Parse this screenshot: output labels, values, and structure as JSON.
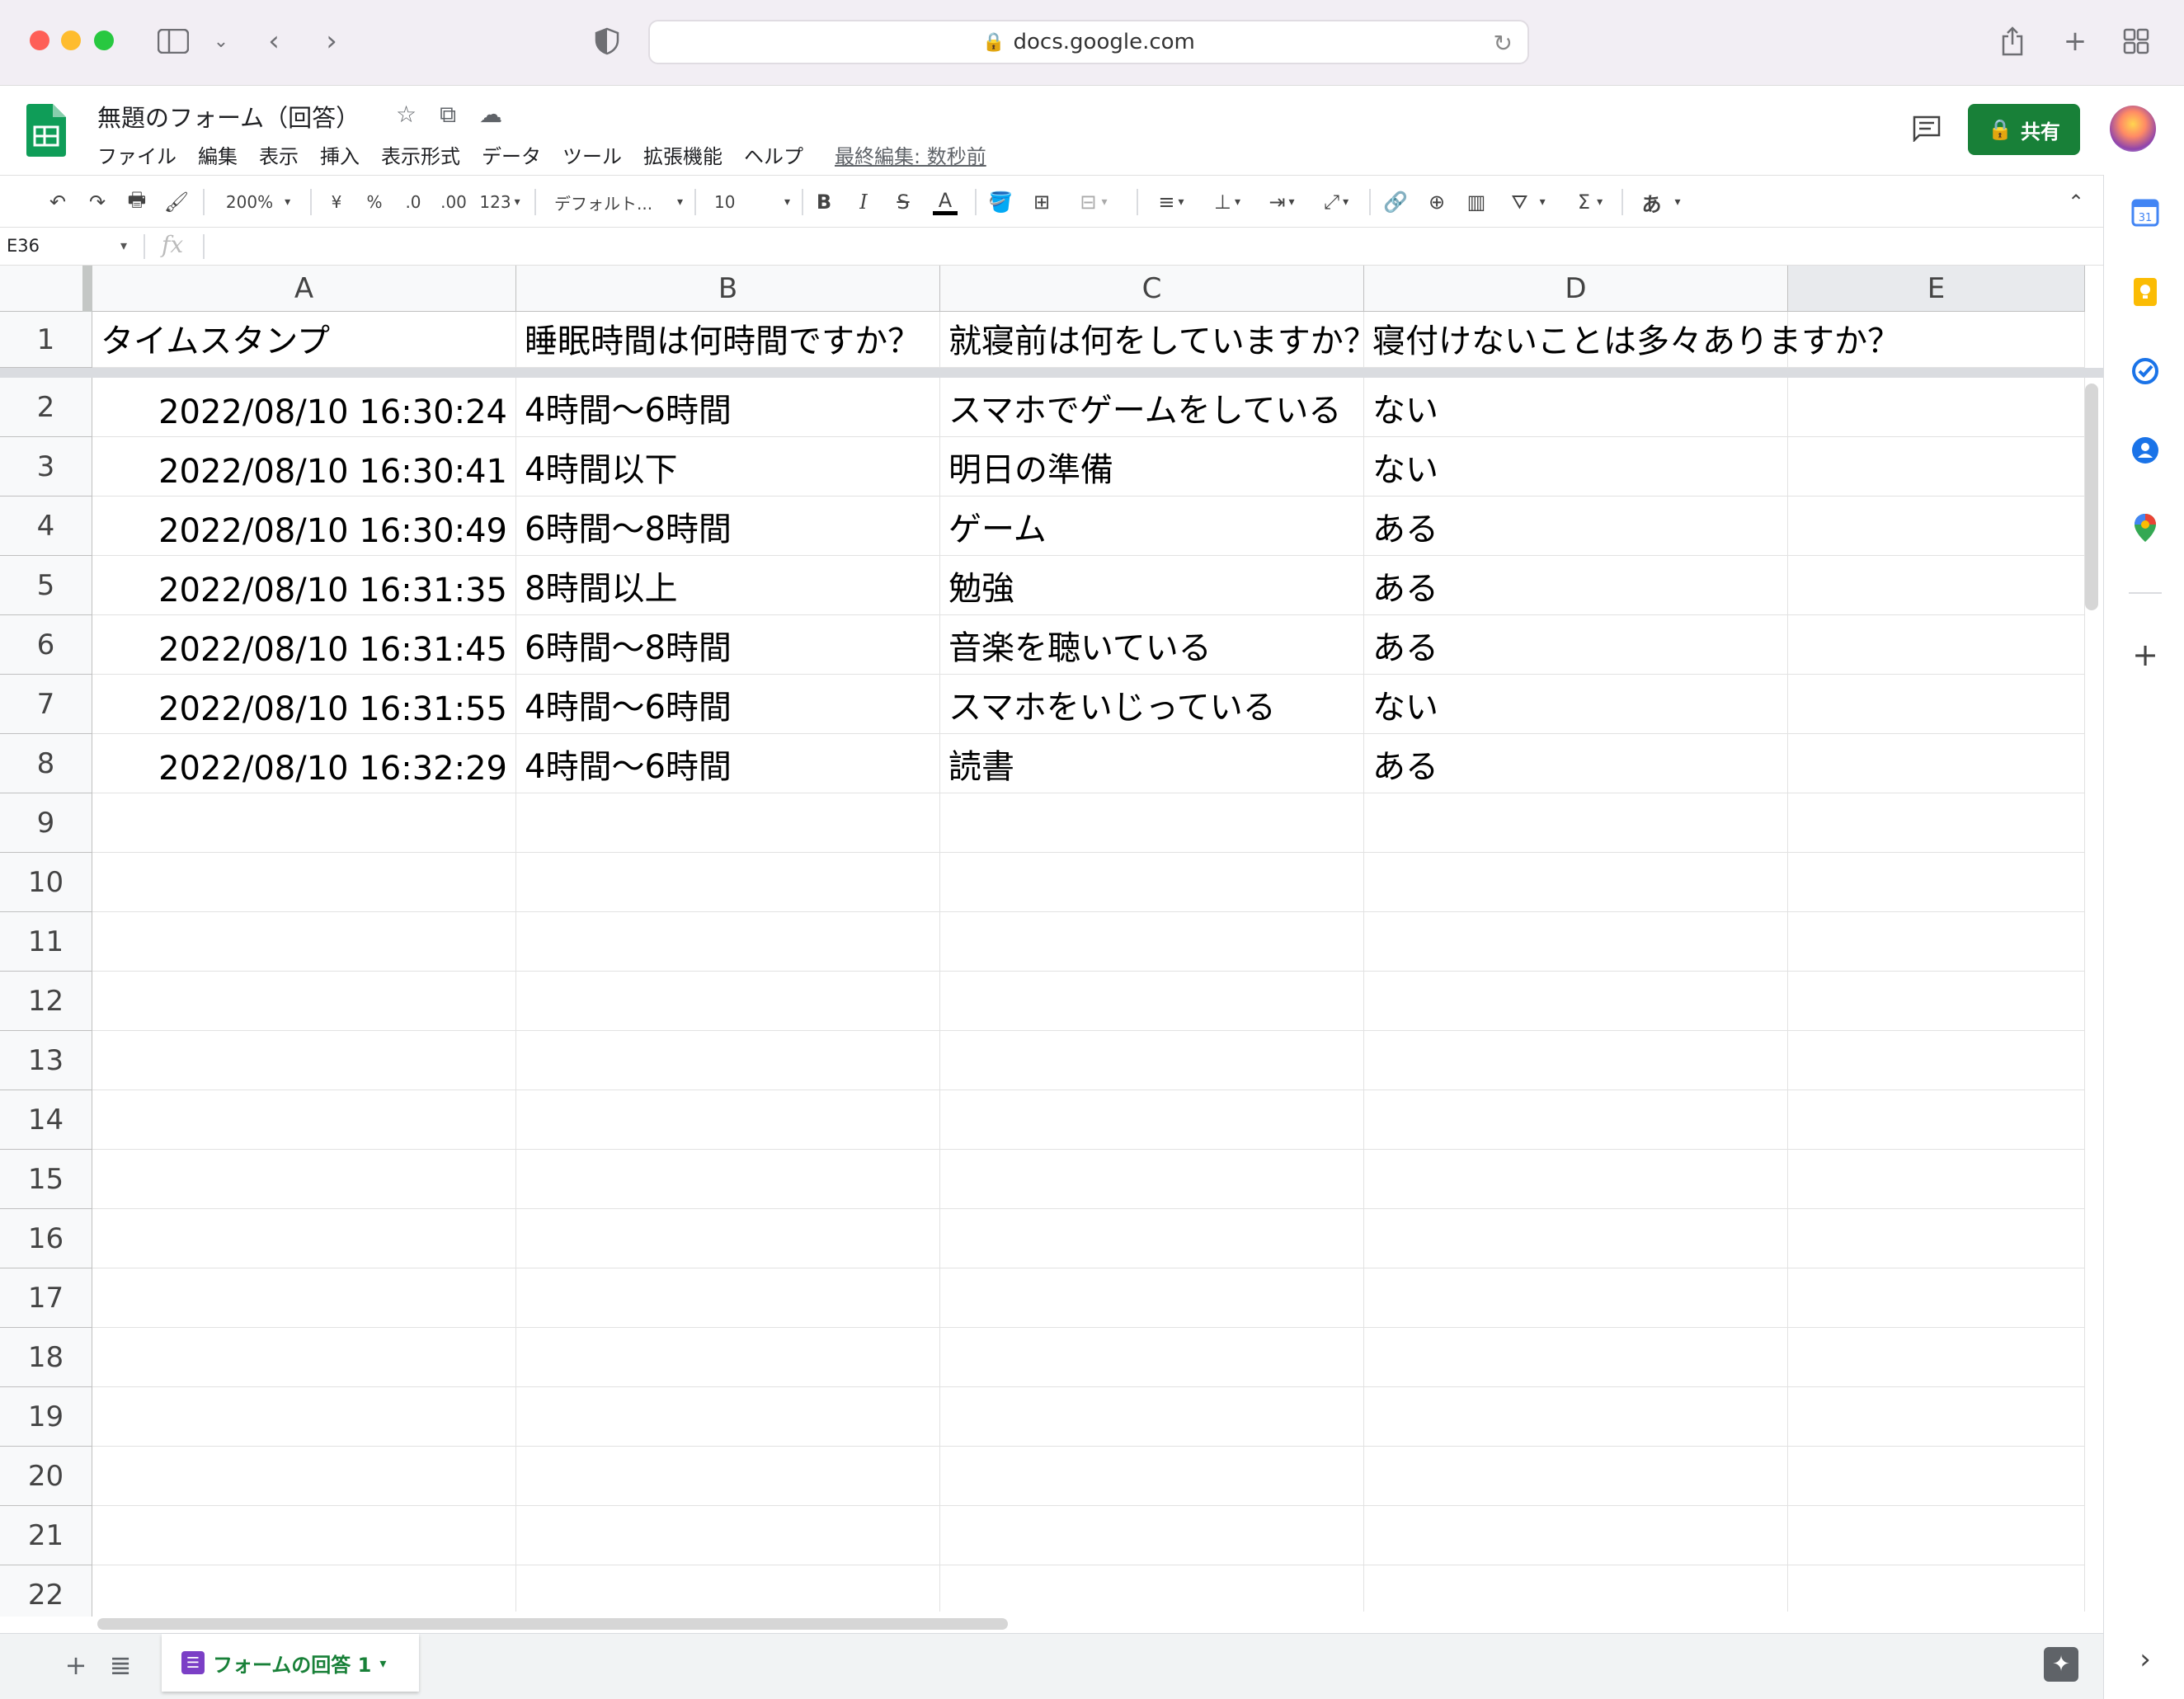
{
  "browser": {
    "url": "docs.google.com"
  },
  "doc": {
    "title": "無題のフォーム（回答）",
    "menus": [
      "ファイル",
      "編集",
      "表示",
      "挿入",
      "表示形式",
      "データ",
      "ツール",
      "拡張機能",
      "ヘルプ"
    ],
    "last_edit": "最終編集: 数秒前",
    "share_label": "共有"
  },
  "toolbar": {
    "zoom": "200%",
    "currency": "¥",
    "percent": "%",
    "dec_decrease": ".0",
    "dec_increase": ".00",
    "number_format": "123",
    "font": "デフォルト...",
    "font_size": "10",
    "input_tool": "あ"
  },
  "formula": {
    "cell_ref": "E36",
    "fx": "fx"
  },
  "grid": {
    "columns": [
      "A",
      "B",
      "C",
      "D",
      "E"
    ],
    "header_row": [
      "タイムスタンプ",
      "睡眠時間は何時間ですか？",
      "就寝前は何をしていますか？",
      "寝付けないことは多々ありますか？",
      ""
    ],
    "rows": [
      [
        "2022/08/10 16:30:24",
        "4時間〜6時間",
        "スマホでゲームをしている",
        "ない"
      ],
      [
        "2022/08/10 16:30:41",
        "4時間以下",
        "明日の準備",
        "ない"
      ],
      [
        "2022/08/10 16:30:49",
        "6時間〜8時間",
        "ゲーム",
        "ある"
      ],
      [
        "2022/08/10 16:31:35",
        "8時間以上",
        "勉強",
        "ある"
      ],
      [
        "2022/08/10 16:31:45",
        "6時間〜8時間",
        "音楽を聴いている",
        "ある"
      ],
      [
        "2022/08/10 16:31:55",
        "4時間〜6時間",
        "スマホをいじっている",
        "ない"
      ],
      [
        "2022/08/10 16:32:29",
        "4時間〜6時間",
        "読書",
        "ある"
      ]
    ],
    "row_numbers": [
      "1",
      "2",
      "3",
      "4",
      "5",
      "6",
      "7",
      "8",
      "9",
      "10",
      "11",
      "12",
      "13",
      "14",
      "15",
      "16",
      "17",
      "18",
      "19",
      "20",
      "21",
      "22"
    ]
  },
  "sheet_tabs": [
    {
      "label": "フォームの回答 1"
    }
  ],
  "colors": {
    "share_green": "#188038",
    "sheets_green": "#0f9d58",
    "tab_purple": "#7b3fc6"
  }
}
